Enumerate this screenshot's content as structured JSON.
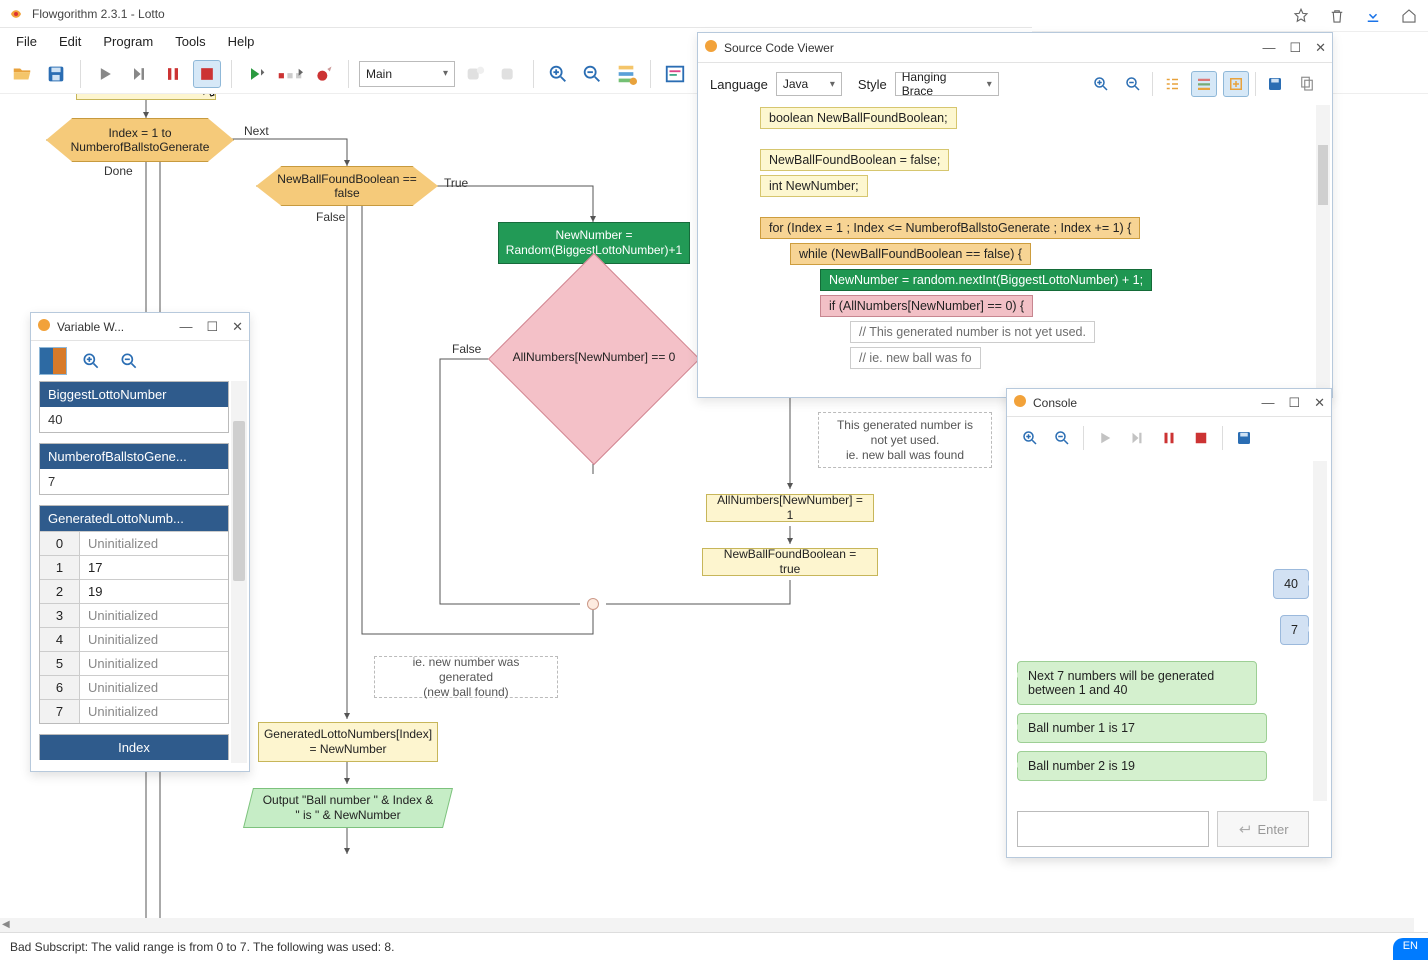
{
  "main_window": {
    "title": "Flowgorithm 2.3.1 - Lotto",
    "menu": [
      "File",
      "Edit",
      "Program",
      "Tools",
      "Help"
    ],
    "procedure_selected": "Main",
    "status": "Bad Subscript: The valid range is from 0 to 7. The following was used: 8.",
    "status_lang": "EN"
  },
  "flowchart": {
    "rect_cut_top": "",
    "hex_for": "Index = 1 to NumberofBallstoGenerate",
    "label_next": "Next",
    "label_done": "Done",
    "hex_while": "NewBallFoundBoolean == false",
    "label_true": "True",
    "label_false_while": "False",
    "rect_rand": "NewNumber = Random(BiggestLottoNumber)+1",
    "diamond_if": "AllNumbers[NewNumber] == 0",
    "label_false_if": "False",
    "comment_notused": "This generated number is not yet used.\nie. new ball was found",
    "rect_setarr": "AllNumbers[NewNumber] = 1",
    "rect_setbool": "NewBallFoundBoolean = true",
    "comment_newnum": "ie. new number was generated\n(new ball found)",
    "rect_store": "GeneratedLottoNumbers[Index] = NewNumber",
    "para_output": "Output \"Ball number \" & Index & \" is \" & NewNumber"
  },
  "var_watch": {
    "title": "Variable W...",
    "vars": [
      {
        "name": "BiggestLottoNumber",
        "value": "40"
      },
      {
        "name": "NumberofBallstoGene...",
        "value": "7"
      }
    ],
    "array": {
      "name": "GeneratedLottoNumb...",
      "rows": [
        {
          "idx": "0",
          "val": "Uninitialized",
          "set": false
        },
        {
          "idx": "1",
          "val": "17",
          "set": true
        },
        {
          "idx": "2",
          "val": "19",
          "set": true
        },
        {
          "idx": "3",
          "val": "Uninitialized",
          "set": false
        },
        {
          "idx": "4",
          "val": "Uninitialized",
          "set": false
        },
        {
          "idx": "5",
          "val": "Uninitialized",
          "set": false
        },
        {
          "idx": "6",
          "val": "Uninitialized",
          "set": false
        },
        {
          "idx": "7",
          "val": "Uninitialized",
          "set": false
        }
      ]
    },
    "peek_next": "Index"
  },
  "source_viewer": {
    "title": "Source Code Viewer",
    "language_label": "Language",
    "language_value": "Java",
    "style_label": "Style",
    "style_value": "Hanging Brace",
    "lines": [
      {
        "cls": "cl-decl",
        "ind": "ind1",
        "t": "boolean NewBallFoundBoolean;"
      },
      {
        "cls": "gap",
        "ind": "",
        "t": ""
      },
      {
        "cls": "cl-decl",
        "ind": "ind1",
        "t": "NewBallFoundBoolean = false;"
      },
      {
        "cls": "cl-decl",
        "ind": "ind1",
        "t": "int NewNumber;"
      },
      {
        "cls": "gap",
        "ind": "",
        "t": ""
      },
      {
        "cls": "cl-for",
        "ind": "ind1",
        "t": "for (Index = 1 ; Index <= NumberofBallstoGenerate ; Index += 1) {"
      },
      {
        "cls": "cl-while",
        "ind": "ind2",
        "t": "while (NewBallFoundBoolean == false) {"
      },
      {
        "cls": "cl-asg",
        "ind": "ind3",
        "t": "NewNumber = random.nextInt(BiggestLottoNumber) + 1;"
      },
      {
        "cls": "cl-if",
        "ind": "ind3",
        "t": "if (AllNumbers[NewNumber] == 0) {"
      },
      {
        "cls": "cl-cmt",
        "ind": "ind4",
        "t": "// This generated number is not yet used."
      },
      {
        "cls": "cl-cmt",
        "ind": "ind4",
        "t": "// ie. new ball was fo"
      }
    ]
  },
  "console": {
    "title": "Console",
    "inputs": [
      "40",
      "7"
    ],
    "outputs": [
      "Next 7 numbers will be generated between 1 and 40",
      "Ball number 1 is 17",
      "Ball number 2 is 19"
    ],
    "enter_label": "Enter"
  }
}
